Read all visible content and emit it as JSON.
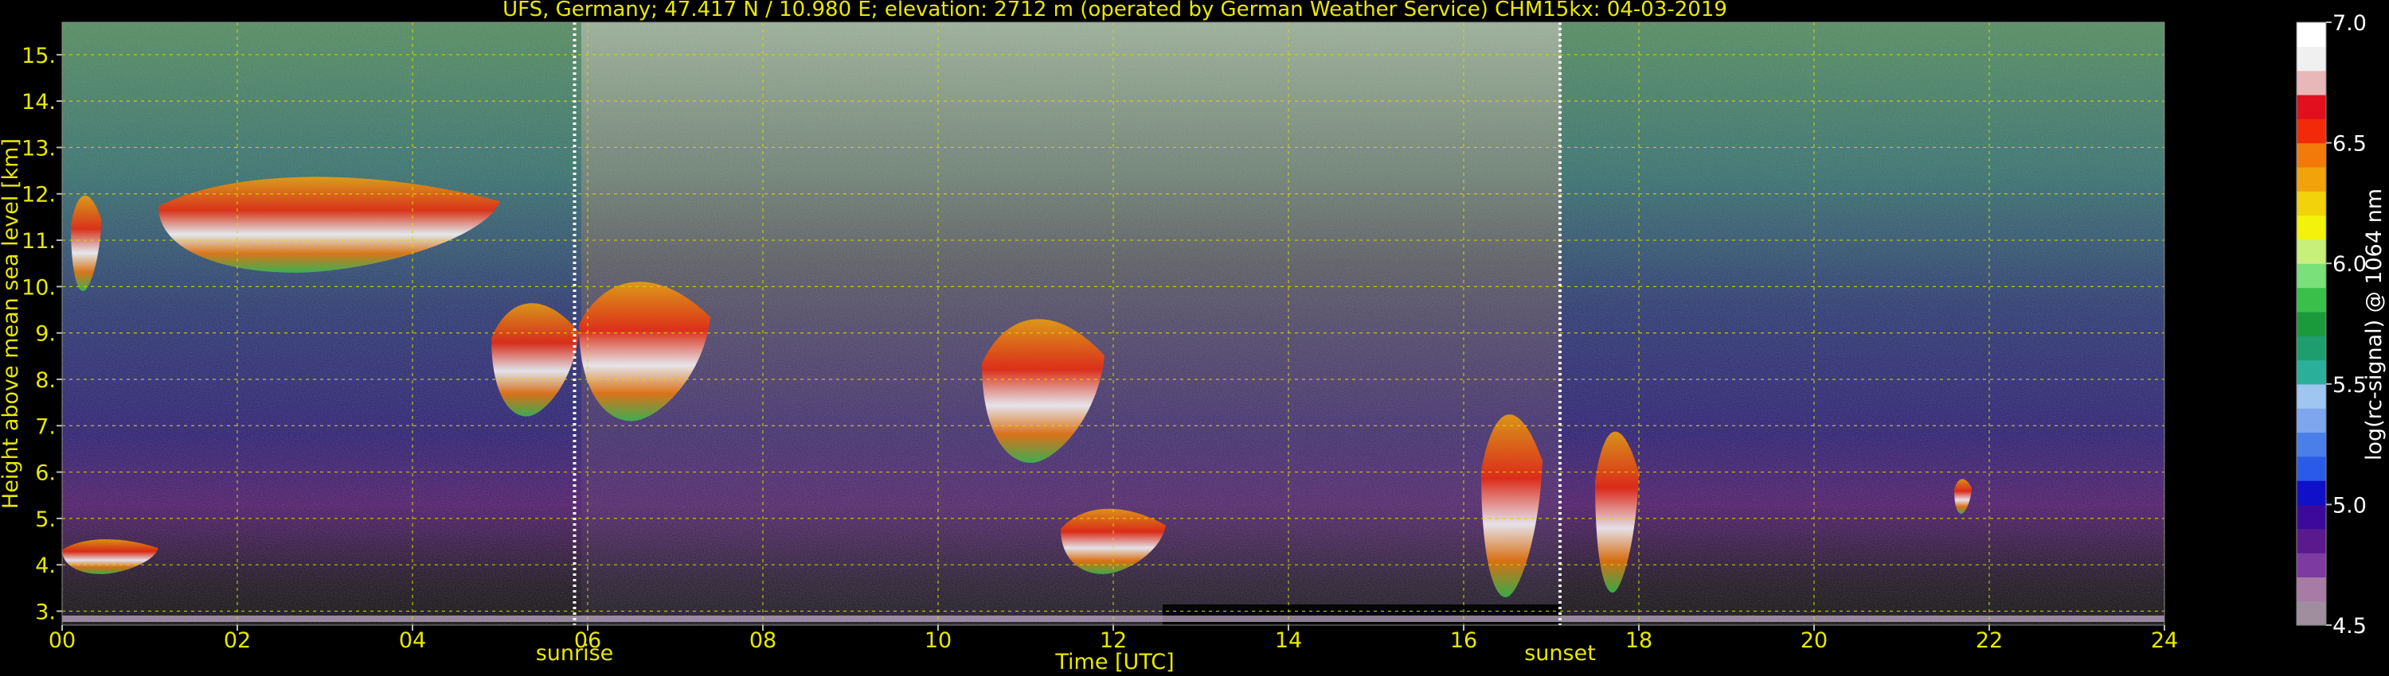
{
  "chart_data": {
    "type": "heatmap",
    "title": "UFS, Germany; 47.417 N / 10.980 E; elevation: 2712 m  (operated by German Weather Service)    CHM15kx: 04-03-2019",
    "xlabel": "Time [UTC]",
    "ylabel": "Height above mean sea level [km]",
    "xlim": [
      0,
      24
    ],
    "ylim": [
      2.7,
      15.7
    ],
    "x_ticks": [
      "00",
      "02",
      "04",
      "06",
      "08",
      "10",
      "12",
      "14",
      "16",
      "18",
      "20",
      "22",
      "24"
    ],
    "x_tick_values": [
      0,
      2,
      4,
      6,
      8,
      10,
      12,
      14,
      16,
      18,
      20,
      22,
      24
    ],
    "y_ticks": [
      "3.",
      "4.",
      "5.",
      "6.",
      "7.",
      "8.",
      "9.",
      "10.",
      "11.",
      "12.",
      "13.",
      "14.",
      "15."
    ],
    "y_tick_values": [
      3,
      4,
      5,
      6,
      7,
      8,
      9,
      10,
      11,
      12,
      13,
      14,
      15
    ],
    "grid": true,
    "colorbar": {
      "label": "log(rc-signal) @ 1064 nm",
      "range": [
        4.5,
        7.0
      ],
      "ticks": [
        "4.5",
        "5.0",
        "5.5",
        "6.0",
        "6.5",
        "7.0"
      ],
      "tick_values": [
        4.5,
        5.0,
        5.5,
        6.0,
        6.5,
        7.0
      ],
      "colors": [
        "#9e8e9e",
        "#a87aa6",
        "#7d3aa0",
        "#5a1a8e",
        "#3b0a9c",
        "#1010c8",
        "#2a5ae8",
        "#4a7ee8",
        "#7ea6ee",
        "#9ec6f0",
        "#2ab09a",
        "#1e9e6e",
        "#1a9a3a",
        "#3ac04a",
        "#7ae07a",
        "#c6f07a",
        "#f2f20a",
        "#f2d20a",
        "#f2a20a",
        "#f27a0a",
        "#f22a0a",
        "#e2101e",
        "#e8b8b8",
        "#f0f0f0",
        "#ffffff"
      ]
    },
    "annotations": [
      {
        "text": "sunrise",
        "x": 5.85
      },
      {
        "text": "sunset",
        "x": 17.1
      }
    ],
    "cloud_layers": [
      {
        "t_start": 0.1,
        "t_end": 0.45,
        "base_km": 9.9,
        "top_km": 12.1
      },
      {
        "t_start": 1.1,
        "t_end": 5.0,
        "base_km": 10.3,
        "top_km": 12.5
      },
      {
        "t_start": 4.9,
        "t_end": 5.9,
        "base_km": 7.2,
        "top_km": 9.8
      },
      {
        "t_start": 5.9,
        "t_end": 7.4,
        "base_km": 7.1,
        "top_km": 10.3
      },
      {
        "t_start": 10.5,
        "t_end": 11.9,
        "base_km": 6.2,
        "top_km": 9.5
      },
      {
        "t_start": 11.4,
        "t_end": 12.6,
        "base_km": 3.8,
        "top_km": 5.3
      },
      {
        "t_start": 0.0,
        "t_end": 1.1,
        "base_km": 3.8,
        "top_km": 4.6
      },
      {
        "t_start": 16.2,
        "t_end": 16.9,
        "base_km": 3.3,
        "top_km": 7.5
      },
      {
        "t_start": 17.5,
        "t_end": 18.0,
        "base_km": 3.4,
        "top_km": 7.1
      },
      {
        "t_start": 21.6,
        "t_end": 21.8,
        "base_km": 5.1,
        "top_km": 5.9
      }
    ]
  }
}
